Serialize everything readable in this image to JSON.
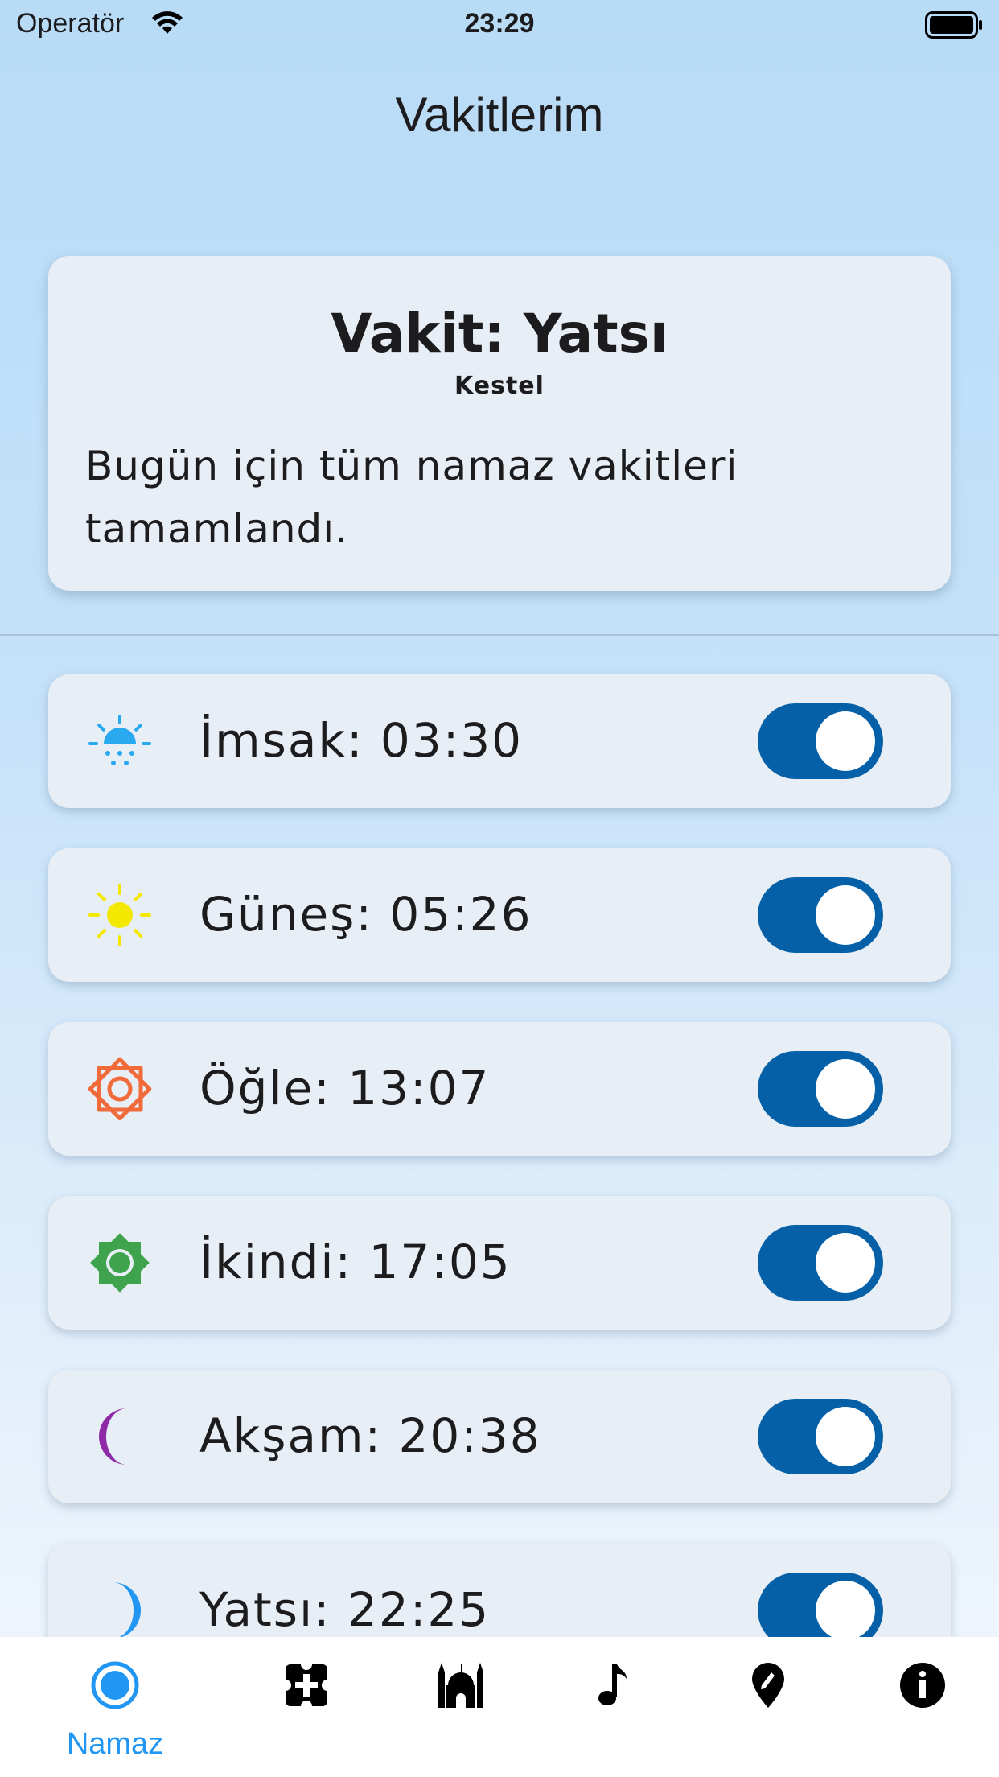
{
  "status_bar": {
    "carrier": "Operatör",
    "time": "23:29"
  },
  "header": {
    "title": "Vakitlerim"
  },
  "current": {
    "title": "Vakit: Yatsı",
    "location": "Kestel",
    "message": "Bugün için tüm namaz vakitleri tamamlandı."
  },
  "prayers": [
    {
      "label": "İmsak: 03:30",
      "icon": "sunrise-dots-icon",
      "color": "#29a9f0",
      "enabled": true
    },
    {
      "label": "Güneş: 05:26",
      "icon": "sun-icon",
      "color": "#f5e800",
      "enabled": true
    },
    {
      "label": "Öğle: 13:07",
      "icon": "octagram-sun-icon",
      "color": "#f06a3a",
      "enabled": true
    },
    {
      "label": "İkindi: 17:05",
      "icon": "star-sun-icon",
      "color": "#3fa34d",
      "enabled": true
    },
    {
      "label": "Akşam: 20:38",
      "icon": "crescent-moon-icon",
      "color": "#8e2aa6",
      "enabled": true
    },
    {
      "label": "Yatsı: 22:25",
      "icon": "crescent-moon-icon",
      "color": "#2196f3",
      "enabled": true
    }
  ],
  "toggle_color": "#0660a8",
  "tabs": [
    {
      "label": "Namaz",
      "icon": "prayer-time-icon",
      "active": true,
      "color": "#2196f3"
    },
    {
      "label": "",
      "icon": "counter-icon",
      "active": false
    },
    {
      "label": "",
      "icon": "mosque-icon",
      "active": false
    },
    {
      "label": "",
      "icon": "music-note-icon",
      "active": false
    },
    {
      "label": "",
      "icon": "location-pin-icon",
      "active": false
    },
    {
      "label": "",
      "icon": "info-icon",
      "active": false
    }
  ]
}
